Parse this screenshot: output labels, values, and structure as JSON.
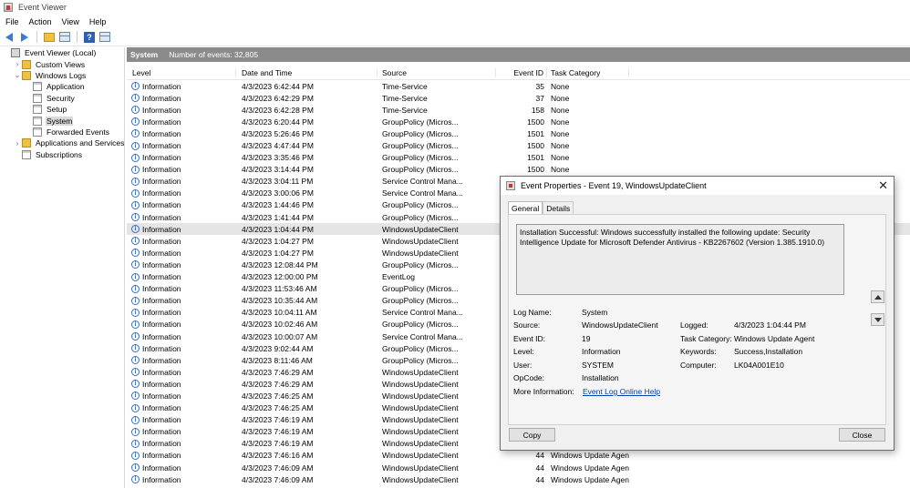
{
  "window": {
    "title": "Event Viewer"
  },
  "menu": [
    "File",
    "Action",
    "View",
    "Help"
  ],
  "tree": [
    {
      "label": "Event Viewer (Local)",
      "level": 0,
      "expander": "",
      "icon": "root"
    },
    {
      "label": "Custom Views",
      "level": 1,
      "expander": "›",
      "icon": "folder"
    },
    {
      "label": "Windows Logs",
      "level": 1,
      "expander": "⌄",
      "icon": "folder"
    },
    {
      "label": "Application",
      "level": 2,
      "expander": "",
      "icon": "log"
    },
    {
      "label": "Security",
      "level": 2,
      "expander": "",
      "icon": "log"
    },
    {
      "label": "Setup",
      "level": 2,
      "expander": "",
      "icon": "log"
    },
    {
      "label": "System",
      "level": 2,
      "expander": "",
      "icon": "log",
      "selected": true
    },
    {
      "label": "Forwarded Events",
      "level": 2,
      "expander": "",
      "icon": "log"
    },
    {
      "label": "Applications and Services Lo",
      "level": 1,
      "expander": "›",
      "icon": "folder"
    },
    {
      "label": "Subscriptions",
      "level": 1,
      "expander": "",
      "icon": "log"
    }
  ],
  "main": {
    "log_name": "System",
    "event_count_label": "Number of events: 32,805",
    "columns": {
      "level": "Level",
      "date": "Date and Time",
      "source": "Source",
      "event_id": "Event ID",
      "task": "Task Category"
    },
    "rows": [
      {
        "level": "Information",
        "date": "4/3/2023 6:42:44 PM",
        "source": "Time-Service",
        "id": "35",
        "task": "None"
      },
      {
        "level": "Information",
        "date": "4/3/2023 6:42:29 PM",
        "source": "Time-Service",
        "id": "37",
        "task": "None"
      },
      {
        "level": "Information",
        "date": "4/3/2023 6:42:28 PM",
        "source": "Time-Service",
        "id": "158",
        "task": "None"
      },
      {
        "level": "Information",
        "date": "4/3/2023 6:20:44 PM",
        "source": "GroupPolicy (Micros...",
        "id": "1500",
        "task": "None"
      },
      {
        "level": "Information",
        "date": "4/3/2023 5:26:46 PM",
        "source": "GroupPolicy (Micros...",
        "id": "1501",
        "task": "None"
      },
      {
        "level": "Information",
        "date": "4/3/2023 4:47:44 PM",
        "source": "GroupPolicy (Micros...",
        "id": "1500",
        "task": "None"
      },
      {
        "level": "Information",
        "date": "4/3/2023 3:35:46 PM",
        "source": "GroupPolicy (Micros...",
        "id": "1501",
        "task": "None"
      },
      {
        "level": "Information",
        "date": "4/3/2023 3:14:44 PM",
        "source": "GroupPolicy (Micros...",
        "id": "1500",
        "task": "None"
      },
      {
        "level": "Information",
        "date": "4/3/2023 3:04:11 PM",
        "source": "Service Control Mana...",
        "id": "",
        "task": ""
      },
      {
        "level": "Information",
        "date": "4/3/2023 3:00:06 PM",
        "source": "Service Control Mana...",
        "id": "",
        "task": ""
      },
      {
        "level": "Information",
        "date": "4/3/2023 1:44:46 PM",
        "source": "GroupPolicy (Micros...",
        "id": "",
        "task": ""
      },
      {
        "level": "Information",
        "date": "4/3/2023 1:41:44 PM",
        "source": "GroupPolicy (Micros...",
        "id": "",
        "task": ""
      },
      {
        "level": "Information",
        "date": "4/3/2023 1:04:44 PM",
        "source": "WindowsUpdateClient",
        "id": "",
        "task": "",
        "selected": true
      },
      {
        "level": "Information",
        "date": "4/3/2023 1:04:27 PM",
        "source": "WindowsUpdateClient",
        "id": "",
        "task": ""
      },
      {
        "level": "Information",
        "date": "4/3/2023 1:04:27 PM",
        "source": "WindowsUpdateClient",
        "id": "",
        "task": ""
      },
      {
        "level": "Information",
        "date": "4/3/2023 12:08:44 PM",
        "source": "GroupPolicy (Micros...",
        "id": "",
        "task": ""
      },
      {
        "level": "Information",
        "date": "4/3/2023 12:00:00 PM",
        "source": "EventLog",
        "id": "",
        "task": ""
      },
      {
        "level": "Information",
        "date": "4/3/2023 11:53:46 AM",
        "source": "GroupPolicy (Micros...",
        "id": "",
        "task": ""
      },
      {
        "level": "Information",
        "date": "4/3/2023 10:35:44 AM",
        "source": "GroupPolicy (Micros...",
        "id": "",
        "task": ""
      },
      {
        "level": "Information",
        "date": "4/3/2023 10:04:11 AM",
        "source": "Service Control Mana...",
        "id": "",
        "task": ""
      },
      {
        "level": "Information",
        "date": "4/3/2023 10:02:46 AM",
        "source": "GroupPolicy (Micros...",
        "id": "",
        "task": ""
      },
      {
        "level": "Information",
        "date": "4/3/2023 10:00:07 AM",
        "source": "Service Control Mana...",
        "id": "",
        "task": ""
      },
      {
        "level": "Information",
        "date": "4/3/2023 9:02:44 AM",
        "source": "GroupPolicy (Micros...",
        "id": "",
        "task": ""
      },
      {
        "level": "Information",
        "date": "4/3/2023 8:11:46 AM",
        "source": "GroupPolicy (Micros...",
        "id": "",
        "task": ""
      },
      {
        "level": "Information",
        "date": "4/3/2023 7:46:29 AM",
        "source": "WindowsUpdateClient",
        "id": "",
        "task": ""
      },
      {
        "level": "Information",
        "date": "4/3/2023 7:46:29 AM",
        "source": "WindowsUpdateClient",
        "id": "",
        "task": ""
      },
      {
        "level": "Information",
        "date": "4/3/2023 7:46:25 AM",
        "source": "WindowsUpdateClient",
        "id": "",
        "task": ""
      },
      {
        "level": "Information",
        "date": "4/3/2023 7:46:25 AM",
        "source": "WindowsUpdateClient",
        "id": "",
        "task": ""
      },
      {
        "level": "Information",
        "date": "4/3/2023 7:46:19 AM",
        "source": "WindowsUpdateClient",
        "id": "",
        "task": ""
      },
      {
        "level": "Information",
        "date": "4/3/2023 7:46:19 AM",
        "source": "WindowsUpdateClient",
        "id": "",
        "task": ""
      },
      {
        "level": "Information",
        "date": "4/3/2023 7:46:19 AM",
        "source": "WindowsUpdateClient",
        "id": "",
        "task": ""
      },
      {
        "level": "Information",
        "date": "4/3/2023 7:46:16 AM",
        "source": "WindowsUpdateClient",
        "id": "44",
        "task": "Windows Update Agent"
      },
      {
        "level": "Information",
        "date": "4/3/2023 7:46:09 AM",
        "source": "WindowsUpdateClient",
        "id": "44",
        "task": "Windows Update Agent"
      },
      {
        "level": "Information",
        "date": "4/3/2023 7:46:09 AM",
        "source": "WindowsUpdateClient",
        "id": "44",
        "task": "Windows Update Agent"
      }
    ]
  },
  "dialog": {
    "title": "Event Properties - Event 19, WindowsUpdateClient",
    "close": "✕",
    "tabs": [
      "General",
      "Details"
    ],
    "description": "Installation Successful: Windows successfully installed the following update: Security Intelligence Update for Microsoft Defender Antivirus - KB2267602 (Version 1.385.1910.0)",
    "labels": {
      "log_name": "Log Name:",
      "source": "Source:",
      "event_id": "Event ID:",
      "level": "Level:",
      "user": "User:",
      "opcode": "OpCode:",
      "more_info": "More Information:",
      "logged": "Logged:",
      "task_category": "Task Category:",
      "keywords": "Keywords:",
      "computer": "Computer:"
    },
    "values": {
      "log_name": "System",
      "source": "WindowsUpdateClient",
      "event_id": "19",
      "level": "Information",
      "user": "SYSTEM",
      "opcode": "Installation",
      "more_info_link": "Event Log Online Help",
      "logged": "4/3/2023 1:04:44 PM",
      "task_category": "Windows Update Agent",
      "keywords": "Success,Installation",
      "computer": "LK04A001E10"
    },
    "copy_label": "Copy",
    "close_label": "Close"
  }
}
